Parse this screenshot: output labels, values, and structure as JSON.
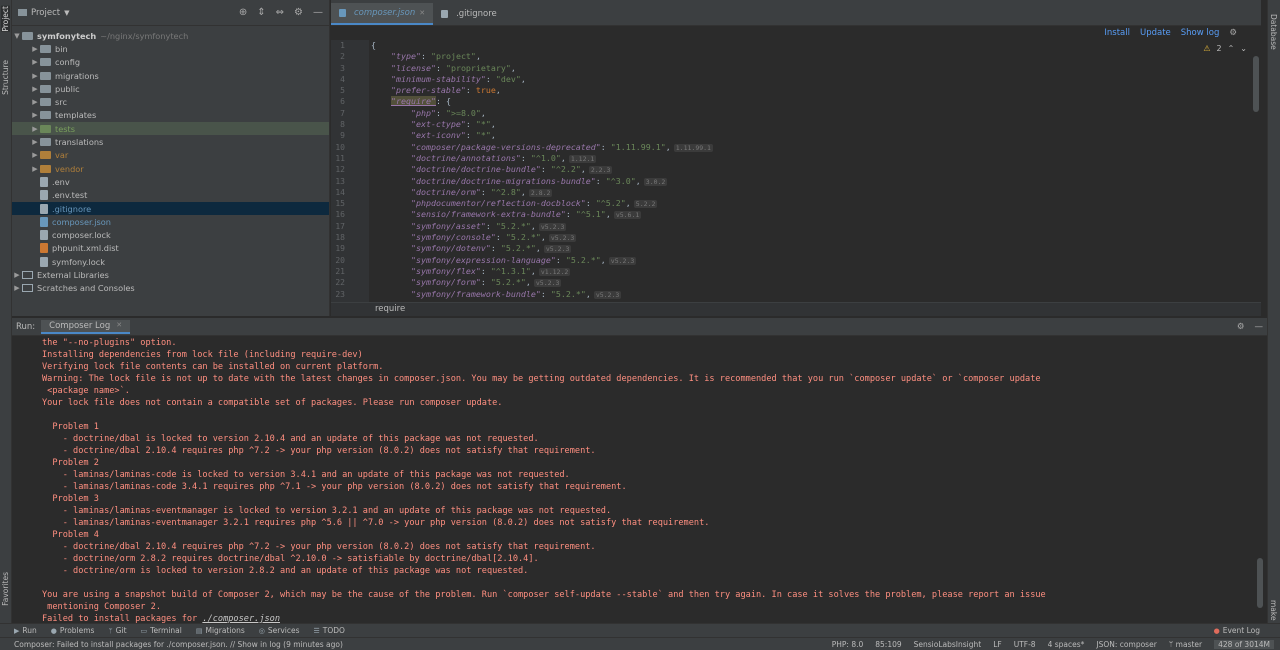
{
  "stripes": {
    "left": [
      "Project",
      "Structure",
      "Favorites"
    ],
    "right": [
      "Database",
      "make"
    ]
  },
  "project": {
    "title": "Project",
    "root_name": "symfonytech",
    "root_path": "~/nginx/symfonytech",
    "tree": [
      {
        "name": "bin",
        "kind": "folder"
      },
      {
        "name": "config",
        "kind": "folder"
      },
      {
        "name": "migrations",
        "kind": "folder"
      },
      {
        "name": "public",
        "kind": "folder"
      },
      {
        "name": "src",
        "kind": "folder"
      },
      {
        "name": "templates",
        "kind": "folder"
      },
      {
        "name": "tests",
        "kind": "folder-green"
      },
      {
        "name": "translations",
        "kind": "folder"
      },
      {
        "name": "var",
        "kind": "folder-orange"
      },
      {
        "name": "vendor",
        "kind": "folder-orange"
      },
      {
        "name": ".env",
        "kind": "file"
      },
      {
        "name": ".env.test",
        "kind": "file"
      },
      {
        "name": ".gitignore",
        "kind": "file-blue"
      },
      {
        "name": "composer.json",
        "kind": "json"
      },
      {
        "name": "composer.lock",
        "kind": "file"
      },
      {
        "name": "phpunit.xml.dist",
        "kind": "xml"
      },
      {
        "name": "symfony.lock",
        "kind": "file"
      }
    ],
    "external": "External Libraries",
    "scratches": "Scratches and Consoles"
  },
  "editor": {
    "tabs": [
      "composer.json",
      ".gitignore"
    ],
    "actions": {
      "install": "Install",
      "update": "Update",
      "show_log": "Show log"
    },
    "warnings_count": "2",
    "breadcrumb": "require",
    "line_numbers": [
      "1",
      "2",
      "3",
      "4",
      "5",
      "6",
      "7",
      "8",
      "9",
      "10",
      "11",
      "12",
      "13",
      "14",
      "15",
      "16",
      "17",
      "18",
      "19",
      "20",
      "21",
      "22",
      "23"
    ]
  },
  "code": {
    "open": "{",
    "fields": [
      {
        "key": "\"type\"",
        "value": "\"project\""
      },
      {
        "key": "\"license\"",
        "value": "\"proprietary\""
      },
      {
        "key": "\"minimum-stability\"",
        "value": "\"dev\""
      },
      {
        "key": "\"prefer-stable\"",
        "value": "true"
      }
    ],
    "require_key": "\"require\"",
    "require_open": ": {",
    "packages": [
      {
        "name": "\"php\"",
        "version": "\">=8.0\"",
        "hint": ""
      },
      {
        "name": "\"ext-ctype\"",
        "version": "\"*\"",
        "hint": ""
      },
      {
        "name": "\"ext-iconv\"",
        "version": "\"*\"",
        "hint": ""
      },
      {
        "name": "\"composer/package-versions-deprecated\"",
        "version": "\"1.11.99.1\"",
        "hint": "1.11.99.1"
      },
      {
        "name": "\"doctrine/annotations\"",
        "version": "\"^1.0\"",
        "hint": "1.12.1"
      },
      {
        "name": "\"doctrine/doctrine-bundle\"",
        "version": "\"^2.2\"",
        "hint": "2.2.3"
      },
      {
        "name": "\"doctrine/doctrine-migrations-bundle\"",
        "version": "\"^3.0\"",
        "hint": "3.0.2"
      },
      {
        "name": "\"doctrine/orm\"",
        "version": "\"^2.8\"",
        "hint": "2.8.2"
      },
      {
        "name": "\"phpdocumentor/reflection-docblock\"",
        "version": "\"^5.2\"",
        "hint": "5.2.2"
      },
      {
        "name": "\"sensio/framework-extra-bundle\"",
        "version": "\"^5.1\"",
        "hint": "v5.6.1"
      },
      {
        "name": "\"symfony/asset\"",
        "version": "\"5.2.*\"",
        "hint": "v5.2.3"
      },
      {
        "name": "\"symfony/console\"",
        "version": "\"5.2.*\"",
        "hint": "v5.2.3"
      },
      {
        "name": "\"symfony/dotenv\"",
        "version": "\"5.2.*\"",
        "hint": "v5.2.3"
      },
      {
        "name": "\"symfony/expression-language\"",
        "version": "\"5.2.*\"",
        "hint": "v5.2.3"
      },
      {
        "name": "\"symfony/flex\"",
        "version": "\"^1.3.1\"",
        "hint": "v1.12.2"
      },
      {
        "name": "\"symfony/form\"",
        "version": "\"5.2.*\"",
        "hint": "v5.2.3"
      },
      {
        "name": "\"symfony/framework-bundle\"",
        "version": "\"5.2.*\"",
        "hint": "v5.2.3"
      }
    ]
  },
  "run": {
    "label": "Run:",
    "tab": "Composer Log",
    "lines": [
      "the \"--no-plugins\" option.",
      "Installing dependencies from lock file (including require-dev)",
      "Verifying lock file contents can be installed on current platform.",
      "Warning: The lock file is not up to date with the latest changes in composer.json. You may be getting outdated dependencies. It is recommended that you run `composer update` or `composer update",
      " <package name>`.",
      "Your lock file does not contain a compatible set of packages. Please run composer update.",
      "",
      "  Problem 1",
      "    - doctrine/dbal is locked to version 2.10.4 and an update of this package was not requested.",
      "    - doctrine/dbal 2.10.4 requires php ^7.2 -> your php version (8.0.2) does not satisfy that requirement.",
      "  Problem 2",
      "    - laminas/laminas-code is locked to version 3.4.1 and an update of this package was not requested.",
      "    - laminas/laminas-code 3.4.1 requires php ^7.1 -> your php version (8.0.2) does not satisfy that requirement.",
      "  Problem 3",
      "    - laminas/laminas-eventmanager is locked to version 3.2.1 and an update of this package was not requested.",
      "    - laminas/laminas-eventmanager 3.2.1 requires php ^5.6 || ^7.0 -> your php version (8.0.2) does not satisfy that requirement.",
      "  Problem 4",
      "    - doctrine/dbal 2.10.4 requires php ^7.2 -> your php version (8.0.2) does not satisfy that requirement.",
      "    - doctrine/orm 2.8.2 requires doctrine/dbal ^2.10.0 -> satisfiable by doctrine/dbal[2.10.4].",
      "    - doctrine/orm is locked to version 2.8.2 and an update of this package was not requested.",
      "",
      "You are using a snapshot build of Composer 2, which may be the cause of the problem. Run `composer self-update --stable` and then try again. In case it solves the problem, please report an issue",
      " mentioning Composer 2."
    ],
    "last_prefix": "Failed to install packages for ",
    "last_link": "./composer.json"
  },
  "bottom_tools": [
    "Run",
    "Problems",
    "Git",
    "Terminal",
    "Migrations",
    "Services",
    "TODO"
  ],
  "event_log": "Event Log",
  "status": {
    "message": "Composer: Failed to install packages for ./composer.json. // Show in log (9 minutes ago)",
    "php": "PHP: 8.0",
    "position": "85:109",
    "plugin": "SensioLabsInsight",
    "line_sep": "LF",
    "encoding": "UTF-8",
    "indent": "4 spaces*",
    "schema": "JSON: composer",
    "branch": "master",
    "memory": "428 of 3014M"
  }
}
